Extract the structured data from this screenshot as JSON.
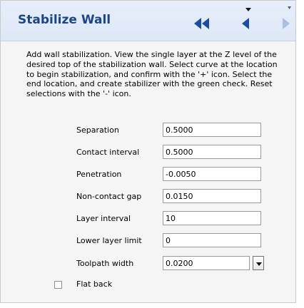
{
  "header": {
    "title": "Stabilize Wall",
    "icons": {
      "rewind": "double-left-arrow-icon",
      "previous": "left-arrow-icon",
      "next": "right-arrow-icon"
    },
    "colors": {
      "title": "#1d4685",
      "nav_active": "#1c4e9a",
      "nav_disabled": "#a9bfdf"
    }
  },
  "description": "Add wall stabilization. View the single layer at the Z level of the desired top of the stabilization wall. Select curve at the location to begin stabilization, and confirm with the '+' icon. Select the end location, and create stabilizer with the green check.  Reset selections with the '-' icon.",
  "fields": {
    "separation": {
      "label": "Separation",
      "value": "0.5000"
    },
    "contact_interval": {
      "label": "Contact interval",
      "value": "0.5000"
    },
    "penetration": {
      "label": "Penetration",
      "value": "-0.0050"
    },
    "non_contact_gap": {
      "label": "Non-contact gap",
      "value": "0.0150"
    },
    "layer_interval": {
      "label": "Layer interval",
      "value": "10"
    },
    "lower_layer_limit": {
      "label": "Lower layer limit",
      "value": "0"
    },
    "toolpath_width": {
      "label": "Toolpath width",
      "value": "0.0200"
    }
  },
  "flat_back": {
    "label": "Flat back",
    "checked": false
  }
}
